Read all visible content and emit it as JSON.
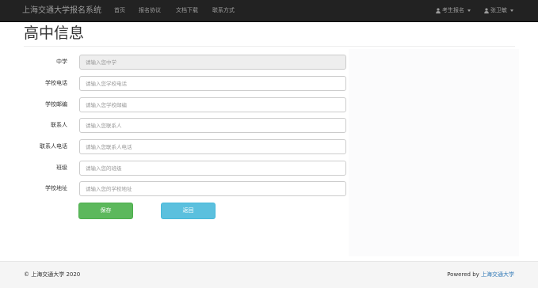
{
  "navbar": {
    "brand": "上海交通大学报名系统",
    "items": [
      "首页",
      "报名协议",
      "文档下载",
      "联系方式"
    ],
    "right_items": [
      {
        "label": "考生报名",
        "icon": "user-icon"
      },
      {
        "label": "张卫敏",
        "icon": "user-icon"
      }
    ]
  },
  "page": {
    "title": "高中信息"
  },
  "form": {
    "fields": [
      {
        "label": "中学",
        "placeholder": "请输入您中学",
        "value": "",
        "readonly": true
      },
      {
        "label": "学校电话",
        "placeholder": "请输入您学校电话",
        "value": ""
      },
      {
        "label": "学校邮编",
        "placeholder": "请输入您学校邮编",
        "value": ""
      },
      {
        "label": "联系人",
        "placeholder": "请输入您联系人",
        "value": ""
      },
      {
        "label": "联系人电话",
        "placeholder": "请输入您联系人电话",
        "value": ""
      },
      {
        "label": "班级",
        "placeholder": "请输入您的班级",
        "value": ""
      },
      {
        "label": "学校地址",
        "placeholder": "请输入您的学校地址",
        "value": ""
      }
    ],
    "save_label": "保存",
    "back_label": "返回"
  },
  "footer": {
    "copyright": "© 上海交通大学 2020",
    "powered_prefix": "Powered by ",
    "powered_link": "上海交通大学"
  },
  "colors": {
    "navbar_bg": "#222222",
    "nav_text": "#9d9d9d",
    "save_button": "#5cb85c",
    "back_button": "#5bc0de",
    "link": "#337ab7",
    "footer_bg": "#f5f5f5"
  }
}
